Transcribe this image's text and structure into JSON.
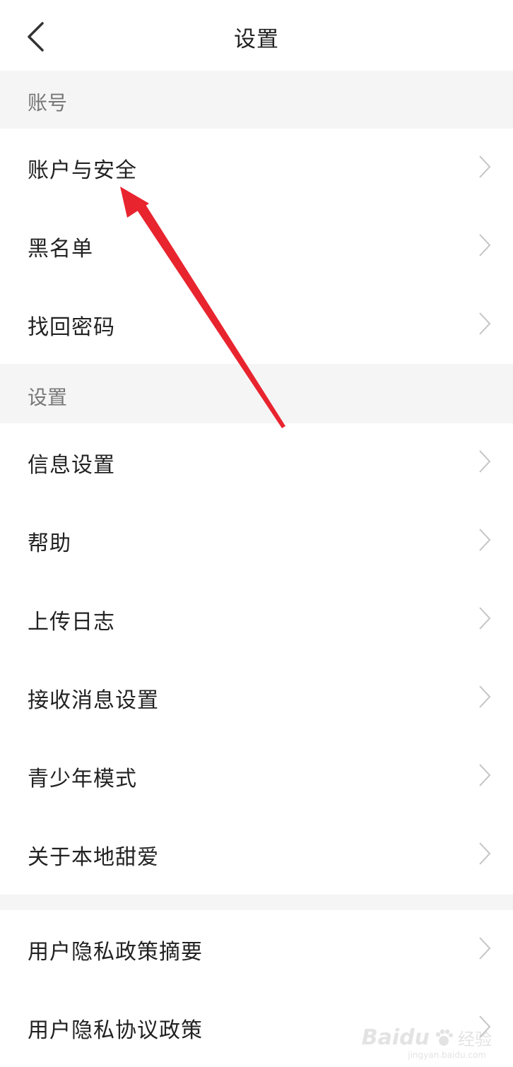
{
  "header": {
    "title": "设置"
  },
  "sections": {
    "account": {
      "label": "账号"
    },
    "settings": {
      "label": "设置"
    }
  },
  "account_items": [
    "账户与安全",
    "黑名单",
    "找回密码"
  ],
  "settings_items": [
    "信息设置",
    "帮助",
    "上传日志",
    "接收消息设置",
    "青少年模式",
    "关于本地甜爱"
  ],
  "policy_items": [
    "用户隐私政策摘要",
    "用户隐私协议政策"
  ],
  "annotation": {
    "arrow_color": "#e8242f"
  },
  "watermark": {
    "brand": "Baidu",
    "cn": "经验",
    "domain": "jingyan.baidu.com"
  }
}
